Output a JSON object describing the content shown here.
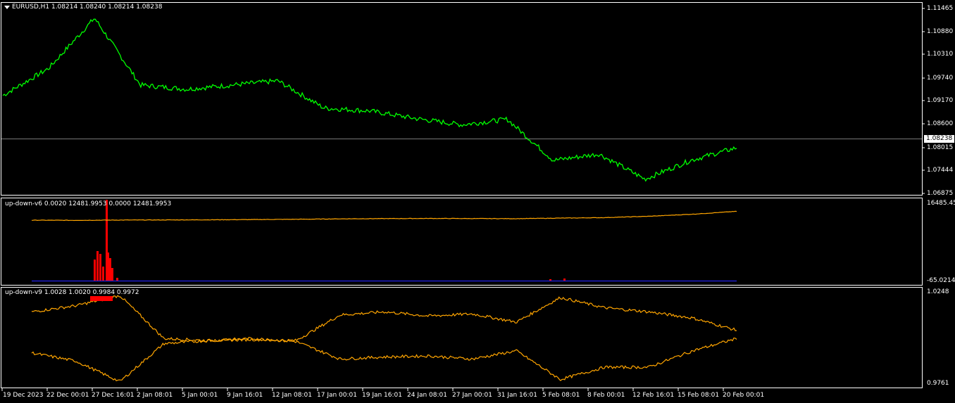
{
  "symbol_info": "EURUSD,H1  1.08214 1.08240 1.08214 1.08238",
  "indicator1_info": "up-down-v6 0.0020 12481.9953 0.0000 12481.9953",
  "indicator2_info": "up-down-v9 1.0028 1.0020 0.9984 0.9972",
  "current_price": "1.08238",
  "main_axis": [
    "1.11465",
    "1.10880",
    "1.10310",
    "1.09740",
    "1.09170",
    "1.08600",
    "1.08015",
    "1.07444",
    "1.06875"
  ],
  "ind1_axis": {
    "top": "16485.450",
    "bottom": "-65.0214"
  },
  "ind2_axis": {
    "top": "1.0248",
    "bottom": "0.9761"
  },
  "time_axis": [
    "19 Dec 2023",
    "22 Dec 00:01",
    "27 Dec 16:01",
    "2 Jan 08:01",
    "5 Jan 00:01",
    "9 Jan 16:01",
    "12 Jan 08:01",
    "17 Jan 00:01",
    "19 Jan 16:01",
    "24 Jan 08:01",
    "27 Jan 00:01",
    "31 Jan 16:01",
    "5 Feb 08:01",
    "8 Feb 00:01",
    "12 Feb 16:01",
    "15 Feb 08:01",
    "20 Feb 00:01"
  ],
  "colors": {
    "price": "#00ff00",
    "ind_line": "#ffa500",
    "ind_hist": "#ff0000",
    "zero_line": "#1e1ecc",
    "frame": "#ffffff"
  },
  "chart_data": {
    "type": "line",
    "price_series": {
      "x": [
        "19 Dec 2023",
        "22 Dec 00:01",
        "27 Dec 16:01",
        "2 Jan 08:01",
        "5 Jan 00:01",
        "9 Jan 16:01",
        "12 Jan 08:01",
        "17 Jan 00:01",
        "19 Jan 16:01",
        "24 Jan 08:01",
        "27 Jan 00:01",
        "31 Jan 16:01",
        "5 Feb 08:01",
        "8 Feb 00:01",
        "12 Feb 16:01",
        "15 Feb 08:01",
        "20 Feb 00:01"
      ],
      "values": [
        1.0925,
        1.099,
        1.111,
        1.095,
        1.094,
        1.095,
        1.096,
        1.0895,
        1.0888,
        1.087,
        1.0855,
        1.0868,
        1.077,
        1.0785,
        1.0725,
        1.077,
        1.08
      ],
      "ylim": [
        1.06875,
        1.11465
      ]
    },
    "up_down_v6": {
      "line_values": [
        12300,
        12280,
        12330,
        12350,
        12380,
        12420,
        12480,
        12560,
        12610,
        12640,
        12620,
        12600,
        12700,
        12800,
        13050,
        13450,
        14000
      ],
      "ylim": [
        -65.0214,
        16485.45
      ]
    },
    "up_down_v9": {
      "upper": [
        1.013,
        1.016,
        1.021,
        1.0,
        0.999,
        0.9995,
        0.999,
        1.0115,
        1.013,
        1.011,
        1.012,
        1.008,
        1.02,
        1.015,
        1.013,
        1.01,
        1.004
      ],
      "lower": [
        0.993,
        0.989,
        0.979,
        0.9975,
        0.999,
        1.0,
        0.9985,
        0.99,
        0.991,
        0.9915,
        0.99,
        0.994,
        0.98,
        0.986,
        0.986,
        0.994,
        1.0
      ],
      "ylim": [
        0.9761,
        1.0248
      ]
    }
  }
}
